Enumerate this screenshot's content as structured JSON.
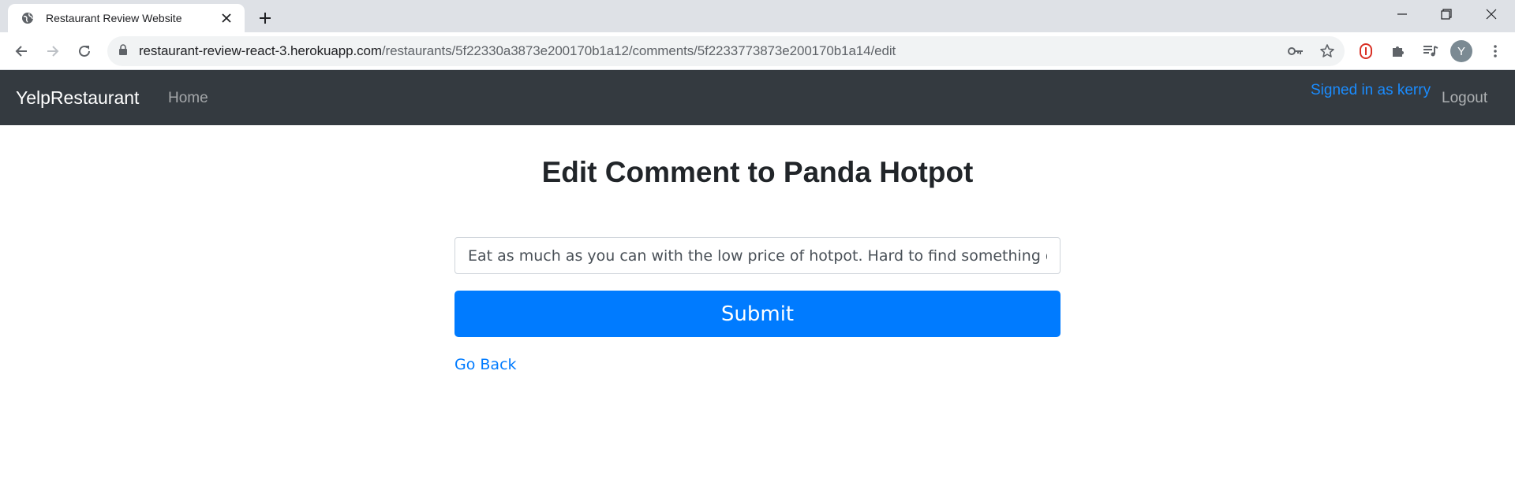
{
  "browser": {
    "tab_title": "Restaurant Review Website",
    "url_host": "restaurant-review-react-3.herokuapp.com",
    "url_path": "/restaurants/5f22330a3873e200170b1a12/comments/5f2233773873e200170b1a14/edit",
    "profile_initial": "Y",
    "icons": [
      "globe-icon",
      "close-icon",
      "plus-icon",
      "minimize-icon",
      "restore-icon",
      "back-icon",
      "forward-icon",
      "reload-icon",
      "lock-icon",
      "key-icon",
      "star-icon",
      "shield-icon",
      "puzzle-icon",
      "media-icon",
      "menu-dots-icon"
    ]
  },
  "navbar": {
    "brand": "YelpRestaurant",
    "home": "Home",
    "signed_in": "Signed in as kerry",
    "logout": "Logout"
  },
  "main": {
    "title": "Edit Comment to Panda Hotpot",
    "comment_value": "Eat as much as you can with the low price of hotpot. Hard to find something delicio",
    "submit_label": "Submit",
    "go_back": "Go Back"
  },
  "colors": {
    "navbar_bg": "#343a40",
    "primary": "#007bff",
    "signed_in": "#1a8cff"
  }
}
